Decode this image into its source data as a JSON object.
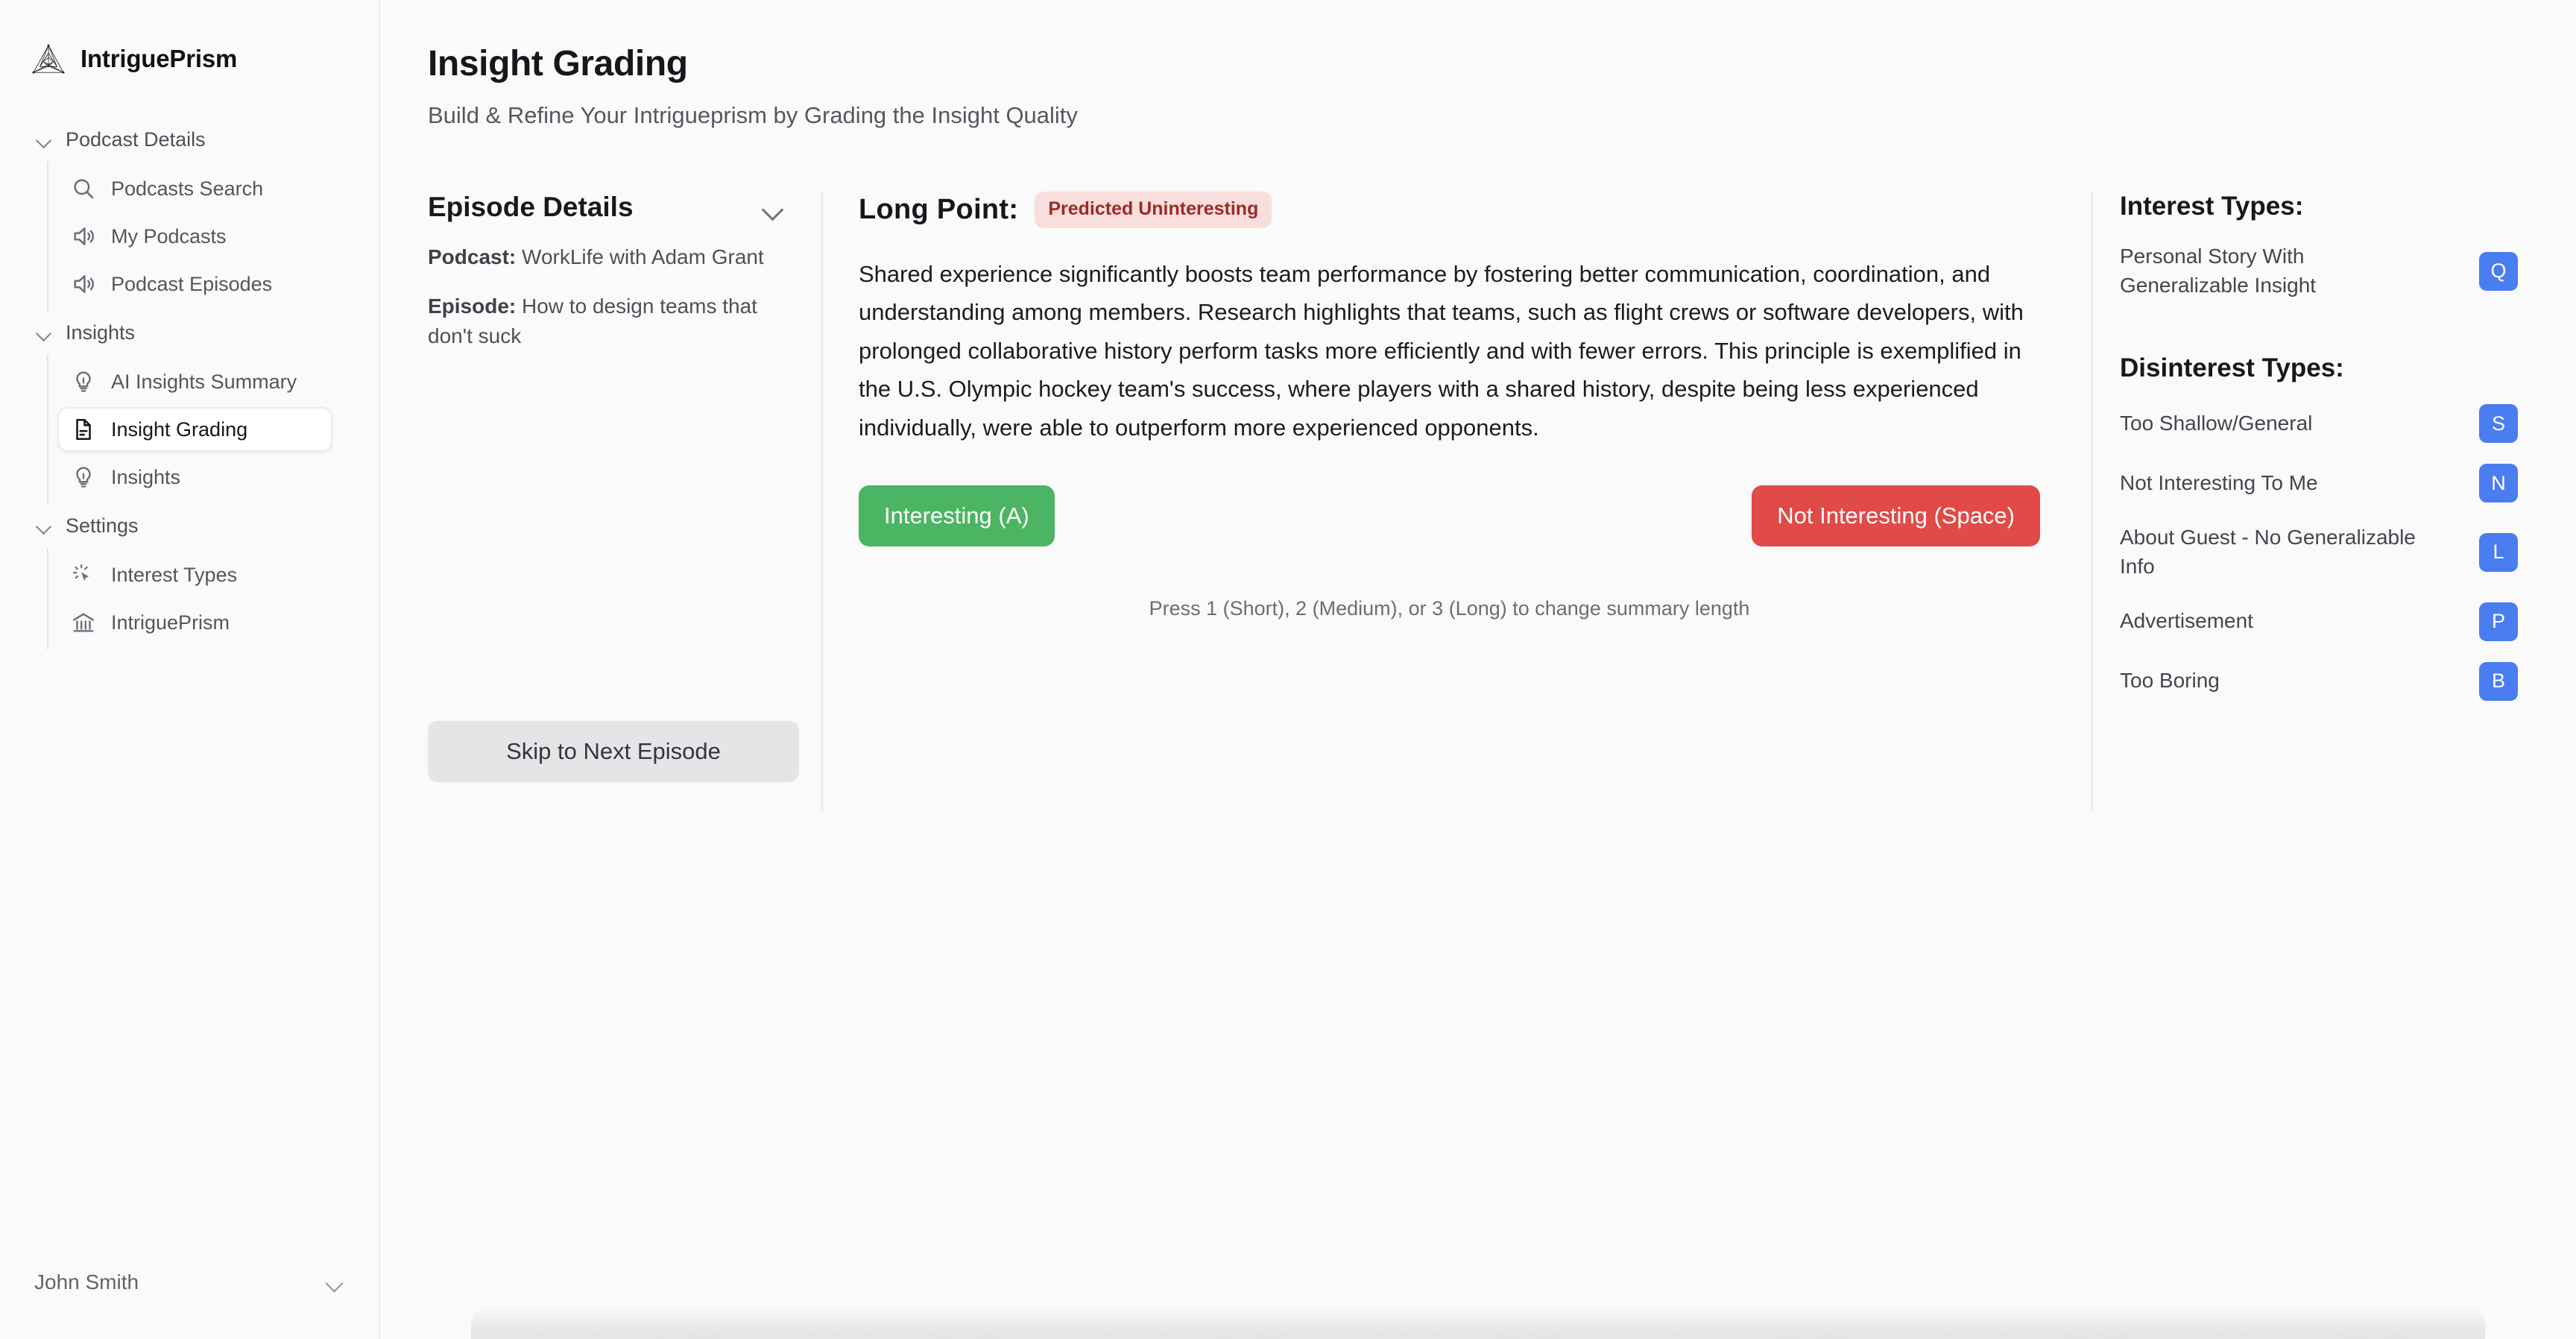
{
  "brand": {
    "name": "IntriguePrism",
    "logo_icon": "prism-logo-icon"
  },
  "sidebar": {
    "groups": [
      {
        "label": "Podcast Details",
        "items": [
          {
            "label": "Podcasts Search",
            "icon": "search-icon",
            "active": false
          },
          {
            "label": "My Podcasts",
            "icon": "speaker-icon",
            "active": false
          },
          {
            "label": "Podcast Episodes",
            "icon": "speaker-icon",
            "active": false
          }
        ]
      },
      {
        "label": "Insights",
        "items": [
          {
            "label": "AI Insights Summary",
            "icon": "lightbulb-icon",
            "active": false
          },
          {
            "label": "Insight Grading",
            "icon": "document-icon",
            "active": true
          },
          {
            "label": "Insights",
            "icon": "lightbulb-icon",
            "active": false
          }
        ]
      },
      {
        "label": "Settings",
        "items": [
          {
            "label": "Interest Types",
            "icon": "cursor-sparkle-icon",
            "active": false
          },
          {
            "label": "IntriguePrism",
            "icon": "bank-icon",
            "active": false
          }
        ]
      }
    ],
    "user": {
      "name": "John Smith",
      "chevron_icon": "chevron-down-icon"
    }
  },
  "header": {
    "title": "Insight Grading",
    "subtitle": "Build & Refine Your Intrigueprism by Grading the Insight Quality"
  },
  "episode_panel": {
    "title": "Episode Details",
    "collapse_icon": "chevron-down-icon",
    "podcast_label": "Podcast:",
    "podcast_value": "WorkLife with Adam Grant",
    "episode_label": "Episode:",
    "episode_value": "How to design teams that don't suck",
    "skip_button": "Skip to Next Episode"
  },
  "point_panel": {
    "label": "Long  Point:",
    "badge": "Predicted Uninteresting",
    "badge_bg": "#f8dedd",
    "badge_color": "#9c2a26",
    "body": "Shared experience significantly boosts team performance by fostering better communication, coordination, and understanding among members. Research highlights that teams, such as flight crews or software developers, with prolonged collaborative history perform tasks more efficiently and with fewer errors. This principle is exemplified in the U.S. Olympic hockey team's success, where players with a shared history, despite being less experienced individually, were able to outperform more experienced opponents.",
    "interesting_button": "Interesting (A)",
    "interesting_color": "#4cb563",
    "not_interesting_button": "Not Interesting (Space)",
    "not_interesting_color": "#e04a47",
    "hint": "Press 1 (Short), 2 (Medium), or 3 (Long) to change summary length"
  },
  "types_panel": {
    "interest_title": "Interest Types:",
    "disinterest_title": "Disinterest Types:",
    "key_badge_color": "#4a7def",
    "interest_types": [
      {
        "label": "Personal Story With Generalizable Insight",
        "key": "Q"
      }
    ],
    "disinterest_types": [
      {
        "label": "Too Shallow/General",
        "key": "S"
      },
      {
        "label": "Not Interesting To Me",
        "key": "N"
      },
      {
        "label": "About Guest - No Generalizable Info",
        "key": "L"
      },
      {
        "label": "Advertisement",
        "key": "P"
      },
      {
        "label": "Too Boring",
        "key": "B"
      }
    ]
  }
}
